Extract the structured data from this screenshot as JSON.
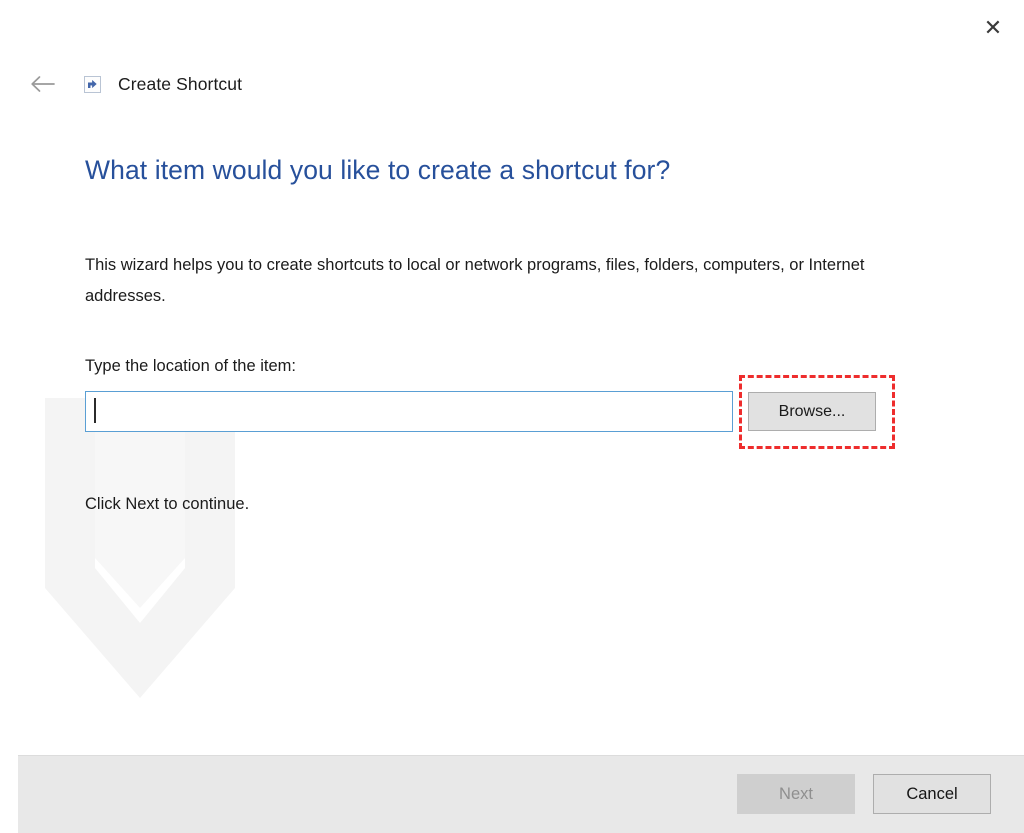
{
  "window": {
    "title": "Create Shortcut",
    "icon": "shortcut-icon",
    "back_icon": "back-arrow-icon",
    "close_icon": "close-icon"
  },
  "content": {
    "heading": "What item would you like to create a shortcut for?",
    "intro": "This wizard helps you to create shortcuts to local or network programs, files, folders, computers, or Internet addresses.",
    "location_label": "Type the location of the item:",
    "location_value": "",
    "location_placeholder": "",
    "browse_label": "Browse...",
    "continue_text": "Click Next to continue."
  },
  "footer": {
    "next_label": "Next",
    "next_enabled": false,
    "cancel_label": "Cancel",
    "cancel_enabled": true
  },
  "annotation": {
    "target": "browse-button",
    "color": "#ee2d2d",
    "style": "dashed-rectangle"
  },
  "colors": {
    "heading_blue": "#27509b",
    "input_border_focus": "#5a9fd4",
    "footer_background": "#e8e8e8",
    "button_face": "#e1e1e1",
    "button_disabled_face": "#cfcfcf",
    "annotation_red": "#ee2d2d",
    "page_background": "#ffffff"
  }
}
